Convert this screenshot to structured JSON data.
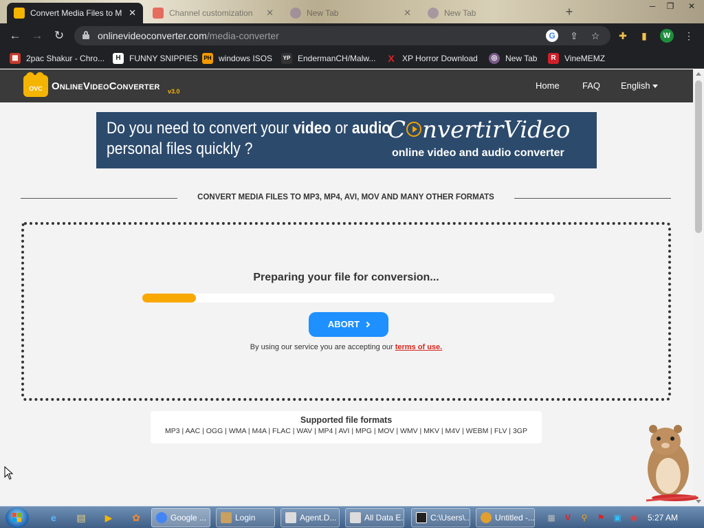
{
  "browser": {
    "tabs": [
      {
        "title": "Convert Media Files to M",
        "close": "✕"
      },
      {
        "title": "Channel customization",
        "close": "✕"
      },
      {
        "title": "New Tab",
        "close": "✕"
      },
      {
        "title": "New Tab",
        "close": ""
      }
    ],
    "new_tab_symbol": "+",
    "url_host": "onlinevideoconverter.com",
    "url_path": "/media-converter",
    "profile_initial": "W",
    "bookmarks": [
      {
        "label": "2pac Shakur - Chro...",
        "icon": "chrome-store-icon",
        "glyph": "▦",
        "color": "#c23b2c"
      },
      {
        "label": "FUNNY SNIPPIES",
        "icon": "h-logo-icon",
        "glyph": "H",
        "color": "#202124"
      },
      {
        "label": "windows ISOS",
        "icon": "ph-logo-icon",
        "glyph": "PH",
        "color": "#f29a00"
      },
      {
        "label": "EndermanCH/Malw...",
        "icon": "yp-logo-icon",
        "glyph": "YP",
        "color": "#333"
      },
      {
        "label": "XP Horror Download",
        "icon": "x-logo-icon",
        "glyph": "X",
        "color": "#202124"
      },
      {
        "label": "New Tab",
        "icon": "spiral-icon",
        "glyph": "◎",
        "color": "#7a5a8a"
      },
      {
        "label": "VineMEMZ",
        "icon": "r-logo-icon",
        "glyph": "R",
        "color": "#d0202a"
      }
    ]
  },
  "site": {
    "logo_text": "OnlineVideoConverter",
    "logo_badge": "OVC",
    "version": "v3.0",
    "nav": [
      "Home",
      "FAQ",
      "English"
    ]
  },
  "banner": {
    "q_part1": "Do you need to convert your ",
    "q_video": "video",
    "q_or": " or ",
    "q_audio": "audio",
    "q_line2": "personal files quickly ?",
    "brand_c": "C",
    "brand_rest": "nvertirVideo",
    "brand_sub": "online video and audio converter"
  },
  "main": {
    "section_title": "CONVERT MEDIA FILES TO MP3, MP4, AVI, MOV AND MANY OTHER FORMATS",
    "status": "Preparing your file for conversion...",
    "progress_percent": 13,
    "abort_label": "ABORT",
    "terms_prefix": "By using our service you are accepting our ",
    "terms_link": "terms of use."
  },
  "formats": {
    "title": "Supported file formats",
    "list": "MP3 | AAC | OGG | WMA | M4A | FLAC | WAV | MP4 | AVI | MPG | MOV | WMV | MKV | M4V | WEBM | FLV | 3GP"
  },
  "taskbar": {
    "tasks": [
      {
        "label": "Google ...",
        "icon": "chrome-icon",
        "color": "#4285f4",
        "active": true
      },
      {
        "label": "Login",
        "icon": "user-icon",
        "color": "#c8a060",
        "active": false
      },
      {
        "label": "Agent.D...",
        "icon": "window-icon",
        "color": "#dcdcdc",
        "active": false
      },
      {
        "label": "All Data E...",
        "icon": "window-icon",
        "color": "#dcdcdc",
        "active": false
      },
      {
        "label": "C:\\Users\\...",
        "icon": "7zip-icon",
        "color": "#222",
        "active": false
      },
      {
        "label": "Untitled -...",
        "icon": "paint-icon",
        "color": "#e0a030",
        "active": false
      }
    ],
    "clock": "5:27 AM"
  },
  "colors": {
    "progress": "#f9a800",
    "abort_button": "#1e90ff",
    "link": "#d9261c",
    "banner_bg": "#2c4a6c"
  }
}
